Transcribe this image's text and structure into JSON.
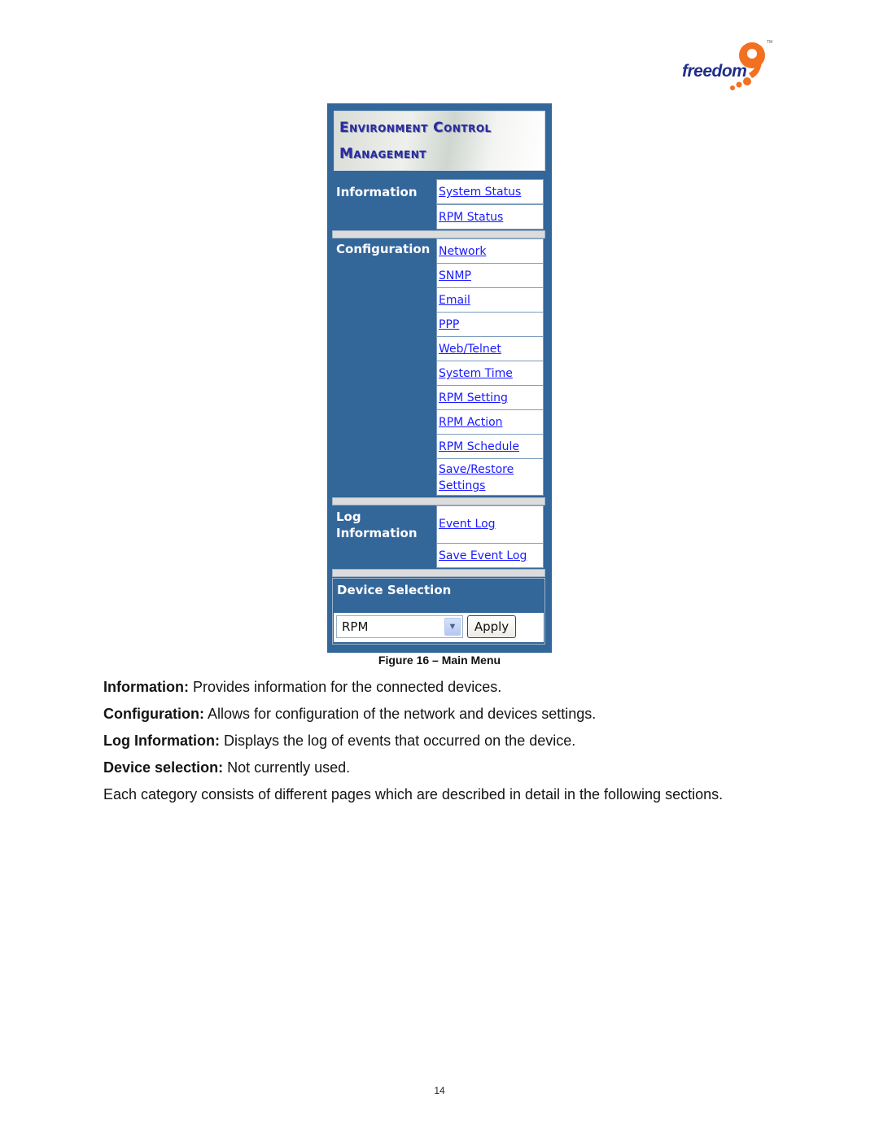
{
  "logo": {
    "text": "freedom",
    "mark": "9",
    "trademark": "TM",
    "brand_color": "#1f2f8a",
    "accent_color": "#f37021"
  },
  "menu": {
    "banner": {
      "line1": "Environment Control",
      "line2": "Management"
    },
    "sections": [
      {
        "label": "Information",
        "links": [
          "System Status",
          "RPM Status"
        ]
      },
      {
        "label": "Configuration",
        "links": [
          "Network",
          "SNMP",
          "Email",
          "PPP",
          "Web/Telnet",
          "System Time",
          "RPM Setting",
          "RPM Action",
          "RPM Schedule",
          "Save/Restore Settings"
        ]
      },
      {
        "label": "Log Information",
        "links": [
          "Event Log",
          "Save Event Log"
        ]
      }
    ],
    "device_selection": {
      "label": "Device Selection",
      "selected": "RPM",
      "apply_label": "Apply"
    },
    "colors": {
      "panel": "#336699",
      "link": "#1a1aff",
      "separator": "#dcdcdc"
    }
  },
  "caption": "Figure 16 – Main Menu",
  "descriptions": [
    {
      "term": "Information:",
      "text": " Provides information for the connected devices."
    },
    {
      "term": "Configuration:",
      "text": " Allows for configuration of the network and devices settings."
    },
    {
      "term": "Log Information:",
      "text": " Displays the log of events that occurred on the device."
    },
    {
      "term": "Device selection:",
      "text": " Not currently used."
    }
  ],
  "summary": "Each category consists of different pages which are described in detail in the following sections.",
  "page_number": "14"
}
